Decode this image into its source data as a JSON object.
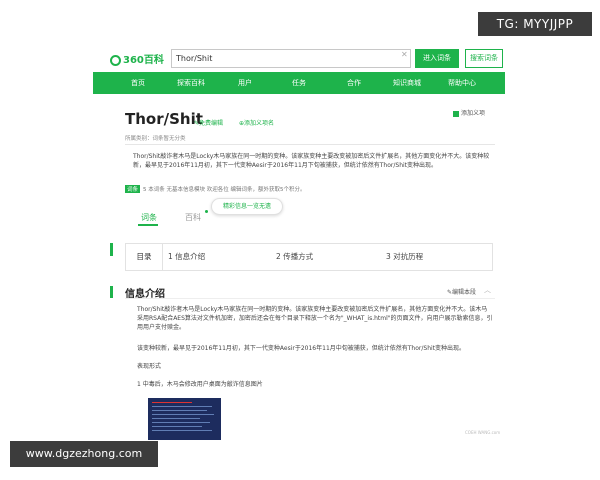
{
  "watermarks": {
    "top": "TG: MYYJJPP",
    "bottom": "www.dgzezhong.com"
  },
  "header": {
    "logo_text": "360百科",
    "search_value": "Thor/Shit",
    "clear_icon": "close-icon",
    "enter_button": "进入词条",
    "search_button": "搜索词条"
  },
  "nav": {
    "items": [
      "首页",
      "探索百科",
      "用户",
      "任务",
      "合作",
      "知识商城",
      "帮助中心"
    ]
  },
  "entry": {
    "title": "Thor/Shit",
    "edit_label": "免费编辑",
    "fav_label": "添加义项名",
    "add_fav_label": "添加义项",
    "category": "所属类别：词条暂无分类",
    "summary": "Thor/Shit敲诈者木马是Locky木马家族在同一时期的变种。该家族变种主要改变被加密后文件扩展名，其他方面变化并不大。该变种较新，最早见于2016年11月初，其下一代变种Aesir于2016年11月下旬被捕获，但统计依然有Thor/Shit变种出现。",
    "notice_badge": "词条",
    "notice_text": "5  本词条 无基本信息模块 欢迎各位 编辑词条，额外获取5个积分。",
    "tab_ci": "词条",
    "tab_baike": "百科",
    "tooltip": "精彩信息一览无遗"
  },
  "toc": {
    "head": "目录",
    "items": [
      "1 信息介绍",
      "2 传播方式",
      "3 对抗历程"
    ]
  },
  "section": {
    "title": "信息介绍",
    "edit_label": "编辑本段",
    "paragraphs": [
      "Thor/Shit敲诈者木马是Locky木马家族在同一时期的变种。该家族变种主要改变被加密后文件扩展名，其他方面变化并不大。该木马采用RSA配合AES算法对文件机加密，加密后还会在每个目录下释放一个名为\"_WHAT_is.html\"的页面文件，向用户展示勒索信息，引用用户支付赎金。",
      "该变种较新，最早见于2016年11月初，其下一代变种Aesir于2016年11月中旬被捕获，但统计依然有Thor/Shit变种出现。",
      "表现形式",
      "1 中毒后，木马会修改用户桌面为敲诈信息图片"
    ],
    "caption": "COEH WANG.com"
  },
  "colors": {
    "brand_green": "#1eb34b",
    "watermark_bg": "#3c3c3c"
  }
}
